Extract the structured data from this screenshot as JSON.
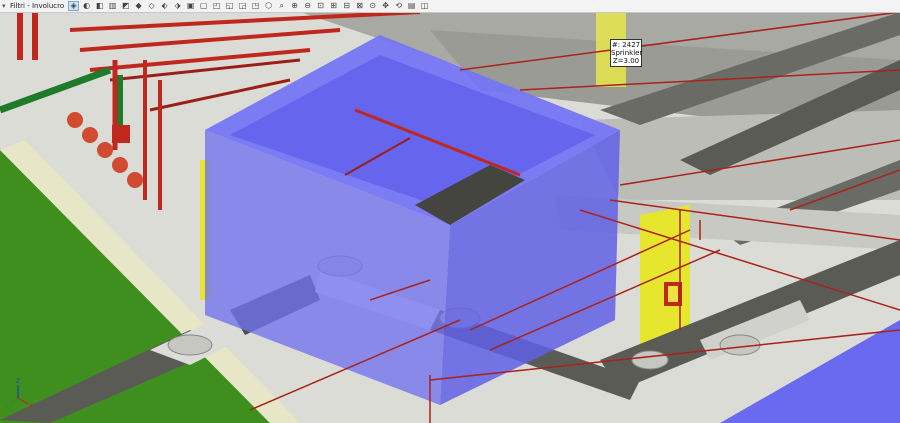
{
  "toolbar": {
    "filter_label": "Filtri - Involucro",
    "filter_icon": "chevron-down-icon",
    "buttons": [
      "view-top-icon",
      "view-front-icon",
      "view-left-icon",
      "view-right-icon",
      "view-back-icon",
      "view-iso-sw-icon",
      "view-iso-se-icon",
      "view-iso-ne-icon",
      "view-iso-nw-icon",
      "cube-shaded-icon",
      "cube-wire-icon",
      "cube-hidden-icon",
      "cube-section-icon",
      "cube-solid-icon",
      "cube-transparent-icon",
      "cube-edges-icon",
      "zoom-icon",
      "zoom-in-icon",
      "zoom-out-icon",
      "zoom-window-icon",
      "zoom-extents-icon",
      "zoom-previous-icon",
      "zoom-selection-icon",
      "zoom-all-icon",
      "pan-icon",
      "orbit-icon",
      "save-icon",
      "export-icon"
    ]
  },
  "tooltip": {
    "line1": "#: 2427",
    "line2": "Sprinkler",
    "line3": "Z=3.00"
  },
  "colors": {
    "tank_blue": "#6f6ff2",
    "pipe_red": "#c0281e",
    "pipe_green": "#1f7a2a",
    "duct_grey": "#5b5b5b",
    "column_yellow": "#e6e62e",
    "ground_green": "#3f8f1f"
  },
  "axis_gizmo": {
    "x": "X",
    "y": "Y",
    "z": "Z"
  }
}
